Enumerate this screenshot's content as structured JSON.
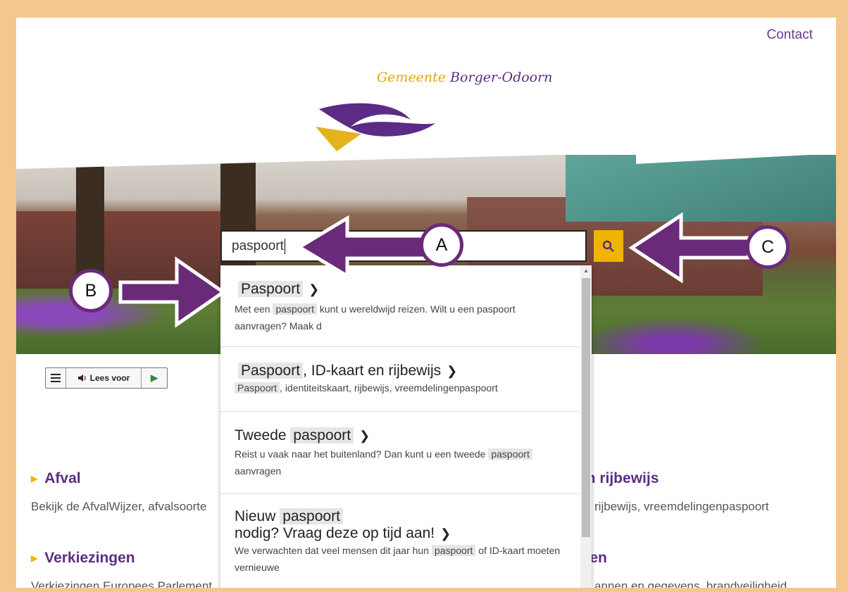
{
  "header": {
    "contact": "Contact",
    "brand_word1": "Gemeente",
    "brand_word2": "Borger-Odoorn"
  },
  "search": {
    "value": "paspoort"
  },
  "suggestions": [
    {
      "title_hl": "Paspoort",
      "title_rest": "",
      "desc_pre": "Met een",
      "desc_hl": "paspoort",
      "desc_post": "kunt u wereldwijd reizen. Wilt u een paspoort aanvragen? Maak d"
    },
    {
      "title_hl": "Paspoort",
      "title_rest": ", ID-kaart en rijbewijs",
      "desc_hl": "Paspoort",
      "desc_post": ", identiteitskaart, rijbewijs, vreemdelingenpaspoort"
    },
    {
      "title_pre": "Tweede",
      "title_hl": "paspoort",
      "desc_pre": "Reist u vaak naar het buitenland? Dan kunt u een tweede",
      "desc_hl": "paspoort",
      "desc_post": "aanvragen"
    },
    {
      "title_pre": "Nieuw",
      "title_hl": "paspoort",
      "title_line2": "nodig? Vraag deze op tijd aan!",
      "desc_pre": "We verwachten dat veel mensen dit jaar hun",
      "desc_hl": "paspoort",
      "desc_post": "of ID-kaart moeten vernieuwe"
    }
  ],
  "tts": {
    "label": "Lees voor"
  },
  "categories": [
    {
      "title": "Afval",
      "desc": "Bekijk de AfvalWijzer, afvalsoorte"
    },
    {
      "title": "Verkiezingen",
      "desc": "Verkiezingen Europees Parlement"
    }
  ],
  "right_partial": [
    {
      "title": "en rijbewijs",
      "desc": "rijbewijs, vreemdelingenpaspoort"
    },
    {
      "title": "wen",
      "desc": "annen en gegevens, brandveiligheid"
    }
  ],
  "annotations": {
    "a": "A",
    "b": "B",
    "c": "C"
  },
  "colors": {
    "brand_purple": "#5a2d82",
    "accent_yellow": "#f0b400",
    "annotation_purple": "#6a2a7a",
    "frame": "#f4c690"
  }
}
